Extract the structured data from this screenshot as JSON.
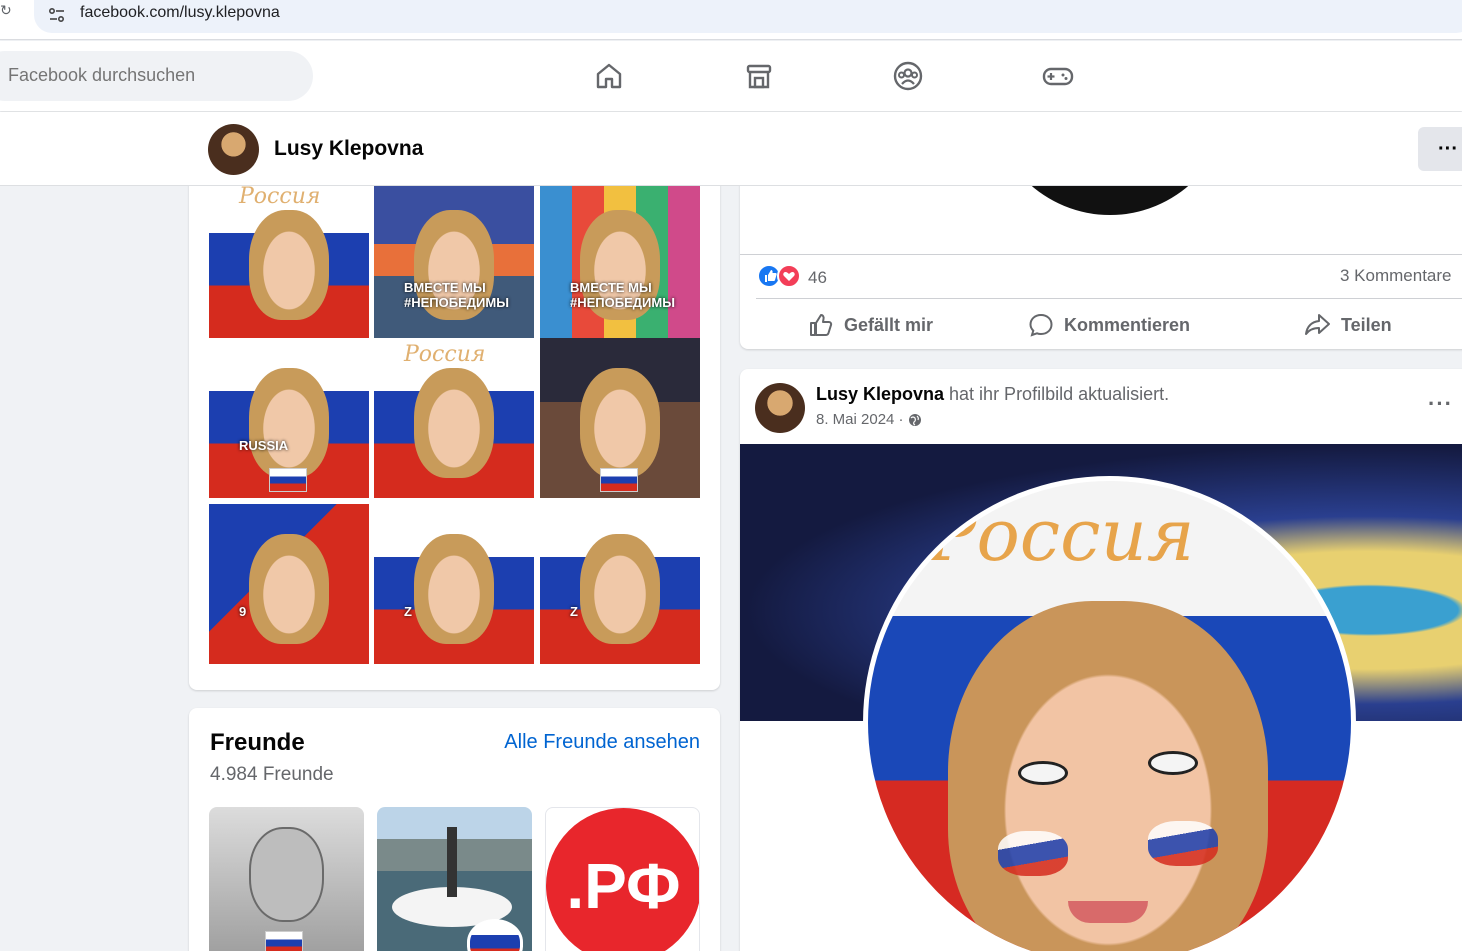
{
  "browser": {
    "url": "facebook.com/lusy.klepovna"
  },
  "nav": {
    "search_placeholder": "Facebook durchsuchen",
    "icons": [
      "home-icon",
      "marketplace-icon",
      "groups-icon",
      "gaming-icon"
    ]
  },
  "profile": {
    "name": "Lusy Klepovna",
    "more_label": "···"
  },
  "photos": {
    "items": [
      {
        "caption": "",
        "script": "Россия"
      },
      {
        "caption": "ВМЕСТЕ МЫ #НЕПОБЕДИМЫ",
        "script": ""
      },
      {
        "caption": "ВМЕСТЕ МЫ #НЕПОБЕДИМЫ",
        "script": ""
      },
      {
        "caption": "RUSSIA",
        "script": ""
      },
      {
        "caption": "",
        "script": "Россия"
      },
      {
        "caption": "",
        "script": ""
      },
      {
        "caption": "9",
        "script": ""
      },
      {
        "caption": "Z",
        "script": ""
      },
      {
        "caption": "Z",
        "script": ""
      }
    ]
  },
  "friends": {
    "title": "Freunde",
    "count": "4.984 Freunde",
    "link": "Alle Freunde ansehen",
    "tile_text": ".РФ"
  },
  "post_top": {
    "reaction_count": "46",
    "comments": "3 Kommentare",
    "like": "Gefällt mir",
    "comment": "Kommentieren",
    "share": "Teilen"
  },
  "post": {
    "author": "Lusy Klepovna",
    "action": " hat ihr Profilbild aktualisiert.",
    "date": "8. Mai 2024 ·",
    "menu": "···",
    "image_title": "Россия"
  },
  "colors": {
    "accent": "#0064d1",
    "flag_white": "#ffffff",
    "flag_blue": "#1c3fb0",
    "flag_red": "#d52b1e"
  }
}
